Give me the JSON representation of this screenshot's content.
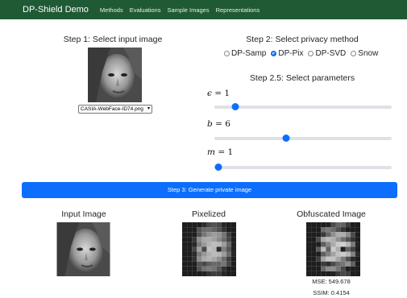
{
  "navbar": {
    "brand": "DP-Shield Demo",
    "links": [
      "Methods",
      "Evaluations",
      "Sample Images",
      "Representations"
    ]
  },
  "step1": {
    "title": "Step 1: Select input image",
    "selected_image": "CASIA-WebFace-ID74.png"
  },
  "step2": {
    "title": "Step 2: Select privacy method",
    "options": [
      "DP-Samp",
      "DP-Pix",
      "DP-SVD",
      "Snow"
    ],
    "selected": "DP-Pix"
  },
  "step25": {
    "title": "Step 2.5: Select parameters",
    "params": [
      {
        "symbol": "ϵ",
        "value": "1",
        "level": 0.1
      },
      {
        "symbol": "b",
        "value": "6",
        "level": 0.4
      },
      {
        "symbol": "m",
        "value": "1",
        "level": 0.0
      }
    ]
  },
  "step3": {
    "label": "Step 3: Generate private image"
  },
  "results": {
    "input_title": "Input Image",
    "pixelized_title": "Pixelized",
    "obfuscated_title": "Obfuscated Image",
    "mse": "MSE: 549.678",
    "ssim": "SSIM: 0.4154"
  },
  "colors": {
    "navbar": "#1f5a34",
    "accent": "#0d6efd"
  }
}
